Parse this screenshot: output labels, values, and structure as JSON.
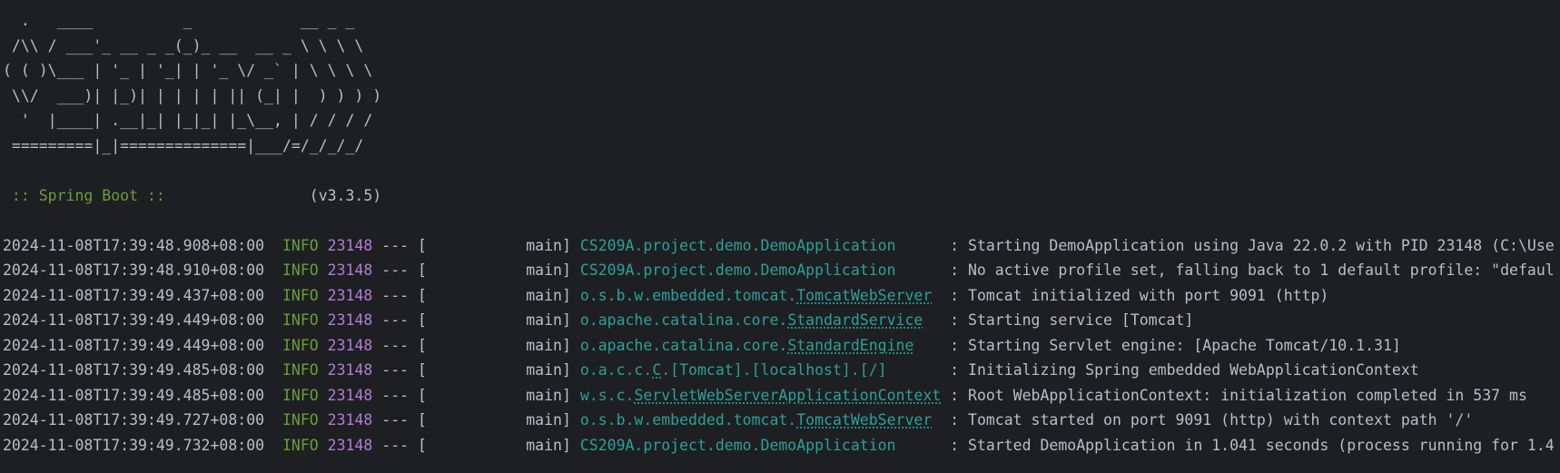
{
  "banner": {
    "art": [
      "  .   ____          _            __ _ _",
      " /\\\\ / ___'_ __ _ _(_)_ __  __ _ \\ \\ \\ \\",
      "( ( )\\___ | '_ | '_| | '_ \\/ _` | \\ \\ \\ \\",
      " \\\\/  ___)| |_)| | | | | || (_| |  ) ) ) )",
      "  '  |____| .__|_| |_|_| |_\\__, | / / / /",
      " =========|_|==============|___/=/_/_/_/"
    ],
    "spring_label": " :: Spring Boot :: ",
    "version": "               (v3.3.5)"
  },
  "logs": [
    {
      "timestamp": "2024-11-08T17:39:48.908+08:00",
      "level": "INFO",
      "pid": "23148",
      "sep": " --- [",
      "thread": "           main] ",
      "logger_prefix": "CS209A.project.demo.DemoApplication",
      "logger_link": "",
      "logger_suffix": "",
      "logger_pad": "      ",
      "message": ": Starting DemoApplication using Java 22.0.2 with PID 23148 (C:\\Use"
    },
    {
      "timestamp": "2024-11-08T17:39:48.910+08:00",
      "level": "INFO",
      "pid": "23148",
      "sep": " --- [",
      "thread": "           main] ",
      "logger_prefix": "CS209A.project.demo.DemoApplication",
      "logger_link": "",
      "logger_suffix": "",
      "logger_pad": "      ",
      "message": ": No active profile set, falling back to 1 default profile: \"defaul"
    },
    {
      "timestamp": "2024-11-08T17:39:49.437+08:00",
      "level": "INFO",
      "pid": "23148",
      "sep": " --- [",
      "thread": "           main] ",
      "logger_prefix": "o.s.b.w.embedded.tomcat.",
      "logger_link": "TomcatWebServer",
      "logger_suffix": "",
      "logger_pad": "  ",
      "message": ": Tomcat initialized with port 9091 (http)"
    },
    {
      "timestamp": "2024-11-08T17:39:49.449+08:00",
      "level": "INFO",
      "pid": "23148",
      "sep": " --- [",
      "thread": "           main] ",
      "logger_prefix": "o.apache.catalina.core.",
      "logger_link": "StandardService",
      "logger_suffix": "",
      "logger_pad": "   ",
      "message": ": Starting service [Tomcat]"
    },
    {
      "timestamp": "2024-11-08T17:39:49.449+08:00",
      "level": "INFO",
      "pid": "23148",
      "sep": " --- [",
      "thread": "           main] ",
      "logger_prefix": "o.apache.catalina.core.",
      "logger_link": "StandardEngine",
      "logger_suffix": "",
      "logger_pad": "    ",
      "message": ": Starting Servlet engine: [Apache Tomcat/10.1.31]"
    },
    {
      "timestamp": "2024-11-08T17:39:49.485+08:00",
      "level": "INFO",
      "pid": "23148",
      "sep": " --- [",
      "thread": "           main] ",
      "logger_prefix": "o.a.c.c.",
      "logger_link": "C",
      "logger_suffix": ".[Tomcat].[localhost].[/]",
      "logger_pad": "       ",
      "message": ": Initializing Spring embedded WebApplicationContext"
    },
    {
      "timestamp": "2024-11-08T17:39:49.485+08:00",
      "level": "INFO",
      "pid": "23148",
      "sep": " --- [",
      "thread": "           main] ",
      "logger_prefix": "w.s.c.",
      "logger_link": "ServletWebServerApplicationContext",
      "logger_suffix": "",
      "logger_pad": " ",
      "message": ": Root WebApplicationContext: initialization completed in 537 ms"
    },
    {
      "timestamp": "2024-11-08T17:39:49.727+08:00",
      "level": "INFO",
      "pid": "23148",
      "sep": " --- [",
      "thread": "           main] ",
      "logger_prefix": "o.s.b.w.embedded.tomcat.",
      "logger_link": "TomcatWebServer",
      "logger_suffix": "",
      "logger_pad": "  ",
      "message": ": Tomcat started on port 9091 (http) with context path '/'"
    },
    {
      "timestamp": "2024-11-08T17:39:49.732+08:00",
      "level": "INFO",
      "pid": "23148",
      "sep": " --- [",
      "thread": "           main] ",
      "logger_prefix": "CS209A.project.demo.DemoApplication",
      "logger_link": "",
      "logger_suffix": "",
      "logger_pad": "      ",
      "message": ": Started DemoApplication in 1.041 seconds (process running for 1.4"
    }
  ]
}
